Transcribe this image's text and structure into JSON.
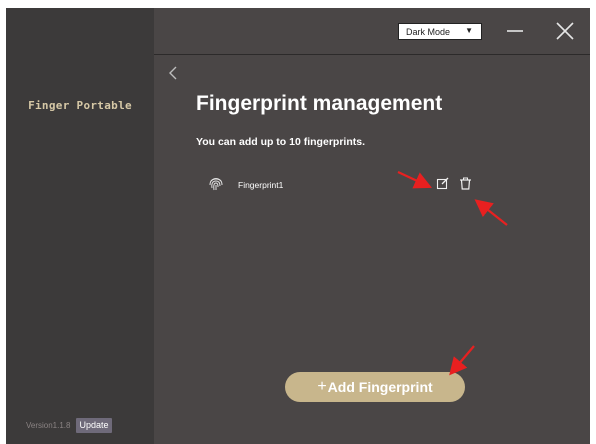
{
  "sidebar": {
    "brand": "Finger Portable",
    "version": "Version1.1.8",
    "update_label": "Update"
  },
  "topbar": {
    "theme_value": "Dark Mode",
    "minimize_icon": "minimize-icon",
    "close_icon": "close-icon"
  },
  "main": {
    "back_icon": "chevron-left-icon",
    "title": "Fingerprint management",
    "subtitle": "You can add up to 10 fingerprints.",
    "fingerprints": [
      {
        "name": "Fingerprint1",
        "icon": "fingerprint-icon",
        "actions": [
          "edit-icon",
          "trash-icon"
        ]
      }
    ],
    "add_label": "Add Fingerprint",
    "add_prefix": "+"
  },
  "colors": {
    "window_bg": "#4a4646",
    "sidebar_bg": "#3c3a3a",
    "brand_text": "#d6c8a6",
    "accent_button": "#c8b68c",
    "update_button": "#6f6a7a",
    "annotation_arrow": "#e82020"
  }
}
